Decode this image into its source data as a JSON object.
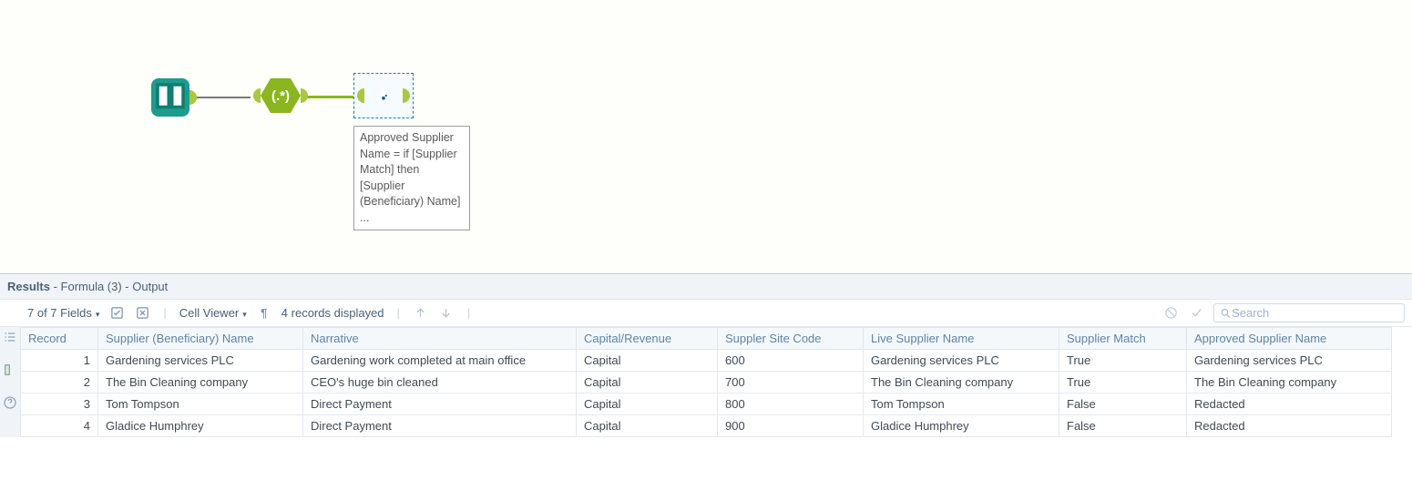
{
  "canvas": {
    "annotation_text": "Approved Supplier Name = if [Supplier Match] then [Supplier (Beneficiary) Name] ...",
    "nodes": {
      "input_icon": "book",
      "regex_label": "(.*)",
      "formula_icon": "flask"
    }
  },
  "results": {
    "title_prefix": "Results",
    "title_suffix": " - Formula (3) - Output",
    "toolbar": {
      "fields_label": "7 of 7 Fields",
      "cell_viewer_label": "Cell Viewer",
      "records_label": "4 records displayed",
      "search_placeholder": "Search"
    },
    "columns": [
      "Record",
      "Supplier (Beneficiary) Name",
      "Narrative",
      "Capital/Revenue",
      "Suppler Site Code",
      "Live Supplier Name",
      "Supplier Match",
      "Approved Supplier Name"
    ],
    "rows": [
      {
        "record": "1",
        "supplier": "Gardening services PLC",
        "narrative": "Gardening work completed at main office",
        "capr": "Capital",
        "site": "600",
        "live": "Gardening services PLC",
        "match": "True",
        "approved": "Gardening services PLC"
      },
      {
        "record": "2",
        "supplier": "The Bin Cleaning company",
        "narrative": "CEO's huge bin cleaned",
        "capr": "Capital",
        "site": "700",
        "live": "The Bin Cleaning company",
        "match": "True",
        "approved": "The Bin Cleaning company"
      },
      {
        "record": "3",
        "supplier": "Tom Tompson",
        "narrative": "Direct Payment",
        "capr": "Capital",
        "site": "800",
        "live": "Tom Tompson",
        "match": "False",
        "approved": "Redacted"
      },
      {
        "record": "4",
        "supplier": "Gladice Humphrey",
        "narrative": "Direct Payment",
        "capr": "Capital",
        "site": "900",
        "live": "Gladice Humphrey",
        "match": "False",
        "approved": "Redacted"
      }
    ]
  }
}
